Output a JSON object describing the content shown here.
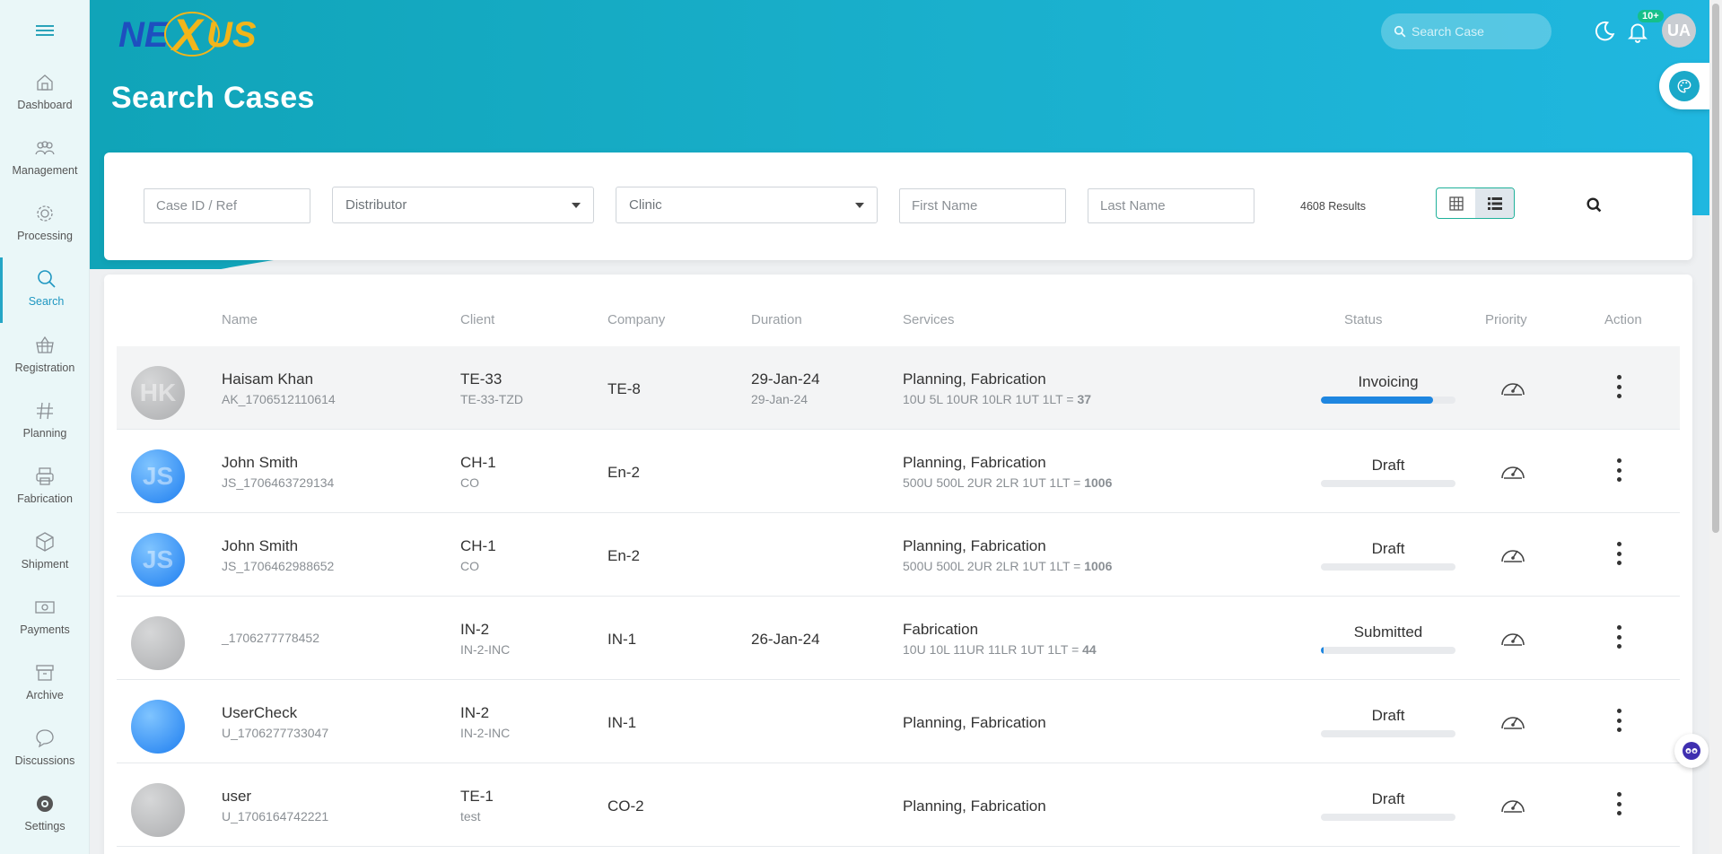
{
  "app": {
    "logo_text": "NEXUS",
    "page_title": "Search Cases"
  },
  "header": {
    "search_placeholder": "Search Case",
    "notification_badge": "10+",
    "user_initials": "UA"
  },
  "sidebar": {
    "items": [
      {
        "label": "Dashboard",
        "icon": "home-icon"
      },
      {
        "label": "Management",
        "icon": "users-icon"
      },
      {
        "label": "Processing",
        "icon": "gear-icon"
      },
      {
        "label": "Search",
        "icon": "search-icon",
        "active": true
      },
      {
        "label": "Registration",
        "icon": "basket-icon"
      },
      {
        "label": "Planning",
        "icon": "hash-icon"
      },
      {
        "label": "Fabrication",
        "icon": "printer-icon"
      },
      {
        "label": "Shipment",
        "icon": "box-icon"
      },
      {
        "label": "Payments",
        "icon": "money-icon"
      },
      {
        "label": "Archive",
        "icon": "archive-icon"
      },
      {
        "label": "Discussions",
        "icon": "chat-icon"
      },
      {
        "label": "Settings",
        "icon": "settings-icon"
      }
    ]
  },
  "filters": {
    "case_id_placeholder": "Case ID / Ref",
    "distributor_label": "Distributor",
    "clinic_label": "Clinic",
    "first_name_placeholder": "First Name",
    "last_name_placeholder": "Last Name",
    "results_text": "4608 Results"
  },
  "table": {
    "headers": {
      "name": "Name",
      "client": "Client",
      "company": "Company",
      "duration": "Duration",
      "services": "Services",
      "status": "Status",
      "priority": "Priority",
      "action": "Action"
    },
    "rows": [
      {
        "initials": "HK",
        "avatar": "grey",
        "name": "Haisam Khan",
        "ref": "AK_1706512110614",
        "client": "TE-33",
        "client_sub": "TE-33-TZD",
        "company": "TE-8",
        "duration": "29-Jan-24",
        "duration_sub": "29-Jan-24",
        "services": "Planning, Fabrication",
        "services_sub": "10U 5L 10UR 10LR 1UT 1LT =",
        "services_total": "37",
        "status": "Invoicing",
        "progress": 0.83
      },
      {
        "initials": "JS",
        "avatar": "blue",
        "name": "John Smith",
        "ref": "JS_1706463729134",
        "client": "CH-1",
        "client_sub": "CO",
        "company": "En-2",
        "duration": "",
        "duration_sub": "",
        "services": "Planning, Fabrication",
        "services_sub": "500U 500L 2UR 2LR 1UT 1LT =",
        "services_total": "1006",
        "status": "Draft",
        "progress": 0
      },
      {
        "initials": "JS",
        "avatar": "blue",
        "name": "John Smith",
        "ref": "JS_1706462988652",
        "client": "CH-1",
        "client_sub": "CO",
        "company": "En-2",
        "duration": "",
        "duration_sub": "",
        "services": "Planning, Fabrication",
        "services_sub": "500U 500L 2UR 2LR 1UT 1LT =",
        "services_total": "1006",
        "status": "Draft",
        "progress": 0
      },
      {
        "initials": "",
        "avatar": "grey",
        "name": "",
        "ref": "_1706277778452",
        "client": "IN-2",
        "client_sub": "IN-2-INC",
        "company": "IN-1",
        "duration": "26-Jan-24",
        "duration_sub": "",
        "services": "Fabrication",
        "services_sub": "10U 10L 11UR 11LR 1UT 1LT =",
        "services_total": "44",
        "status": "Submitted",
        "progress": 0.02
      },
      {
        "initials": "",
        "avatar": "blue",
        "name": "UserCheck",
        "ref": "U_1706277733047",
        "client": "IN-2",
        "client_sub": "IN-2-INC",
        "company": "IN-1",
        "duration": "",
        "duration_sub": "",
        "services": "Planning, Fabrication",
        "services_sub": "",
        "services_total": "",
        "status": "Draft",
        "progress": 0
      },
      {
        "initials": "",
        "avatar": "grey",
        "name": "user",
        "ref": "U_1706164742221",
        "client": "TE-1",
        "client_sub": "test",
        "company": "CO-2",
        "duration": "",
        "duration_sub": "",
        "services": "Planning, Fabrication",
        "services_sub": "",
        "services_total": "",
        "status": "Draft",
        "progress": 0
      }
    ]
  },
  "colors": {
    "accent": "#1aa9c9",
    "progress": "#1e86e0",
    "toggle_border": "#1fb19a"
  }
}
